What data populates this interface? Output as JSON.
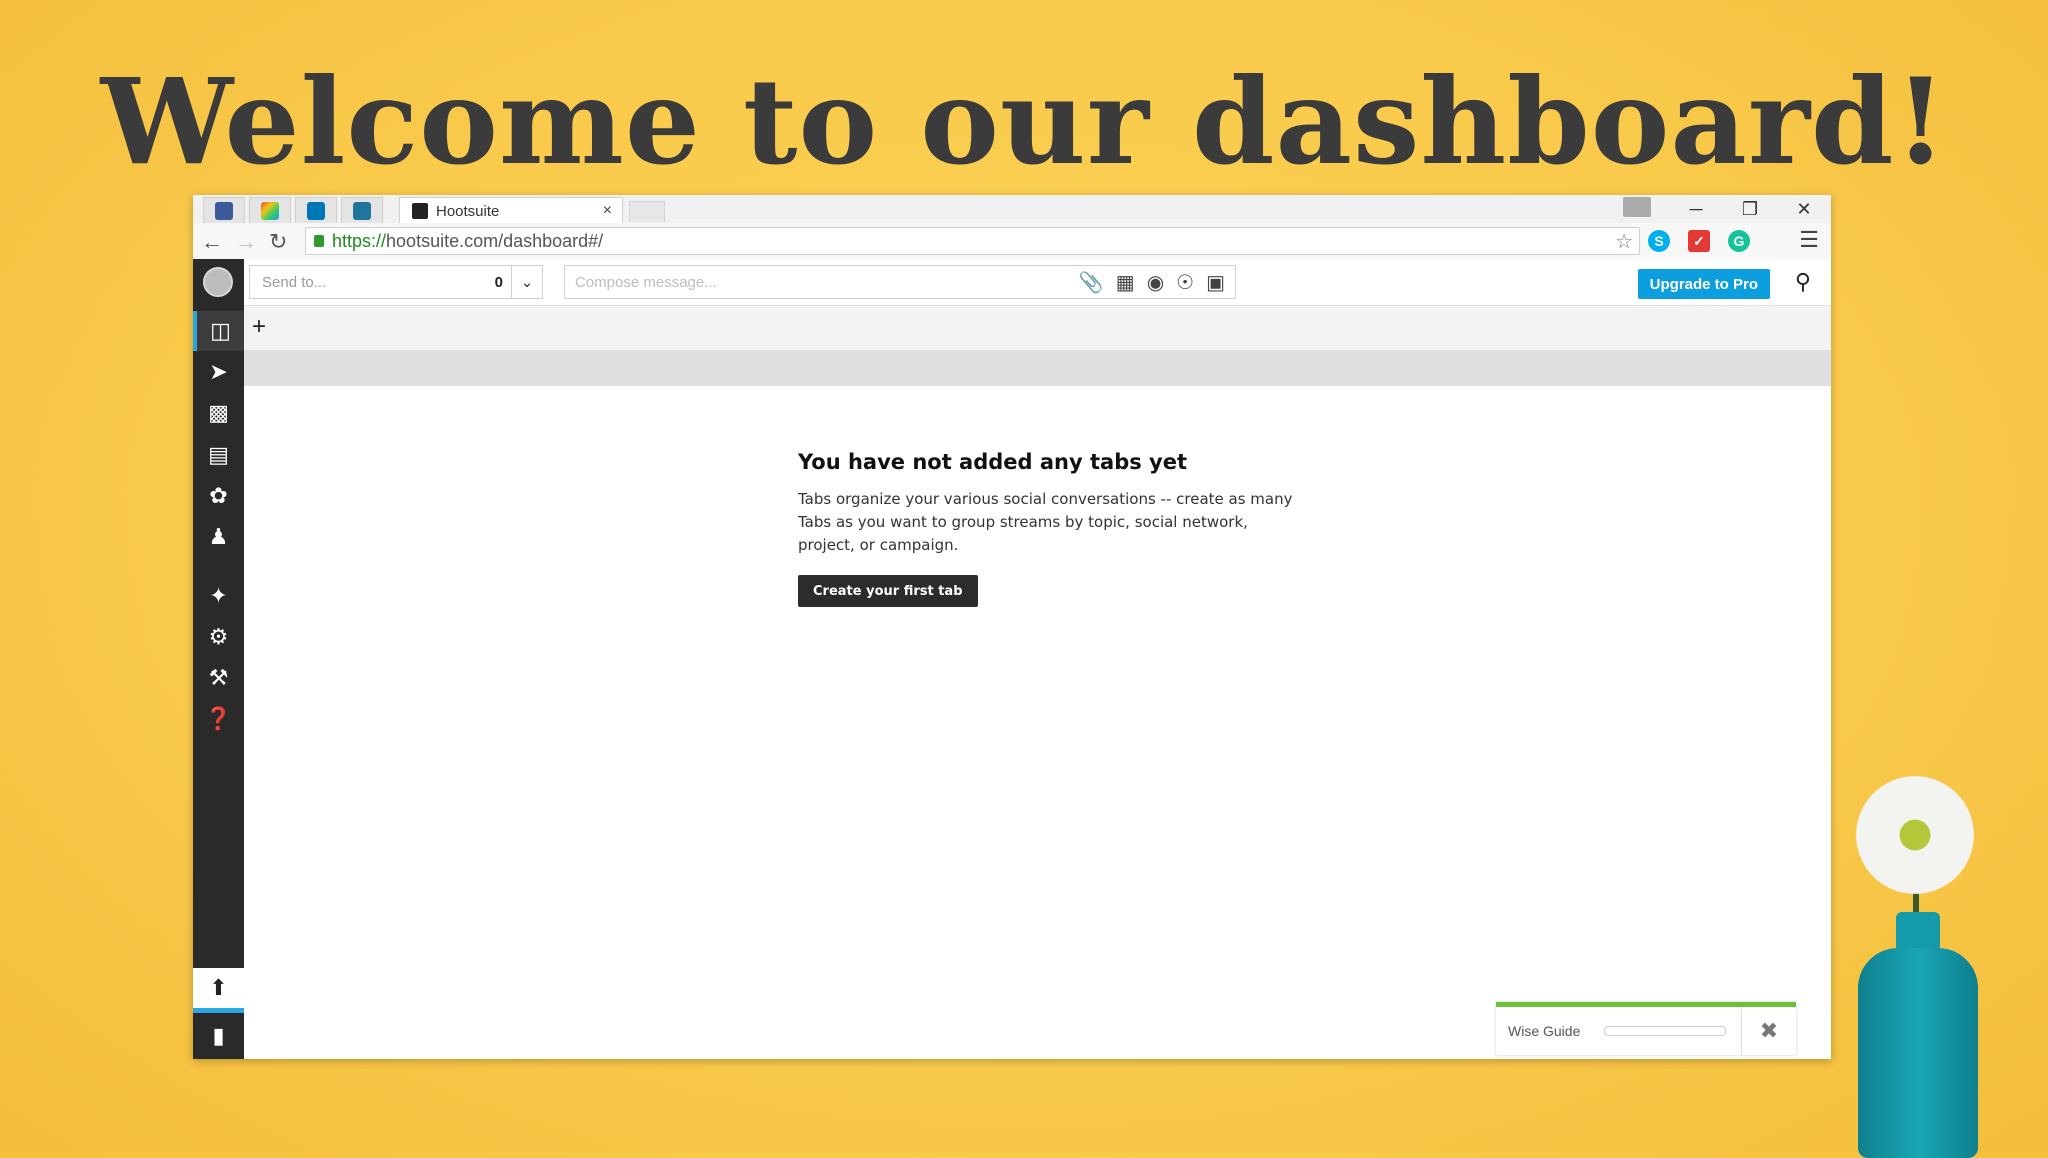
{
  "headline": "Welcome to our dashboard!",
  "browser": {
    "tabs": [
      {
        "icon": "facebook-icon"
      },
      {
        "icon": "colorful-app-icon"
      },
      {
        "icon": "linkedin-icon"
      },
      {
        "icon": "wordpress-icon"
      }
    ],
    "active_tab": {
      "title": "Hootsuite",
      "close": "×"
    },
    "url_protocol": "https://",
    "url_rest": "hootsuite.com/dashboard#/",
    "window_controls": [
      "─",
      "❐",
      "✕"
    ]
  },
  "app": {
    "send_to_placeholder": "Send to...",
    "send_to_count": "0",
    "compose_placeholder": "Compose message...",
    "upgrade_label": "Upgrade to Pro",
    "sidebar_items": [
      "streams-icon",
      "publisher-icon",
      "analytics-icon",
      "assignments-icon",
      "contacts-icon",
      "profile-icon",
      "apps-icon",
      "settings-icon",
      "tools-icon",
      "help-icon"
    ],
    "empty_state": {
      "title": "You have not added any tabs yet",
      "body": "Tabs organize your various social conversations -- create as many Tabs as you want to group streams by topic, social network, project, or campaign.",
      "button": "Create your first tab"
    },
    "wise_guide_label": "Wise Guide"
  },
  "colors": {
    "background": "#f9c94a",
    "accent": "#0d9ee0",
    "sidebar": "#2a2a2a",
    "wise_guide_bar": "#6cbf3b"
  }
}
